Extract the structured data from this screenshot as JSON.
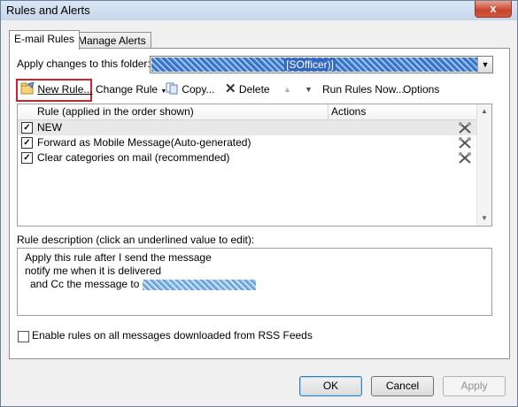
{
  "window": {
    "title": "Rules and Alerts",
    "close_glyph": "x"
  },
  "tabs": [
    {
      "label": "E-mail Rules"
    },
    {
      "label": "Manage Alerts"
    }
  ],
  "folder": {
    "label": "Apply changes to this folder:",
    "value": "[SOfficer)]"
  },
  "toolbar": {
    "new_rule": "New Rule...",
    "change_rule": "Change Rule",
    "copy": "Copy...",
    "delete": "Delete",
    "run_rules_now": "Run Rules Now...",
    "options": "Options"
  },
  "rules_list": {
    "columns": {
      "rule": "Rule (applied in the order shown)",
      "actions": "Actions"
    },
    "rows": [
      {
        "name": "NEW",
        "checked": true,
        "selected": true
      },
      {
        "name": "Forward as Mobile Message(Auto-generated)",
        "checked": true,
        "selected": false
      },
      {
        "name": "Clear categories on mail (recommended)",
        "checked": true,
        "selected": false
      }
    ]
  },
  "description": {
    "label": "Rule description (click an underlined value to edit):",
    "lines": [
      "Apply this rule after I send the message",
      "notify me when it is delivered",
      "and Cc the message to"
    ]
  },
  "rss": {
    "label": "Enable rules on all messages downloaded from RSS Feeds",
    "checked": false
  },
  "buttons": {
    "ok": "OK",
    "cancel": "Cancel",
    "apply": "Apply"
  },
  "colors": {
    "highlight_box": "#d2232a",
    "selection": "#e8e8e8",
    "close_button": "#c7432b"
  }
}
